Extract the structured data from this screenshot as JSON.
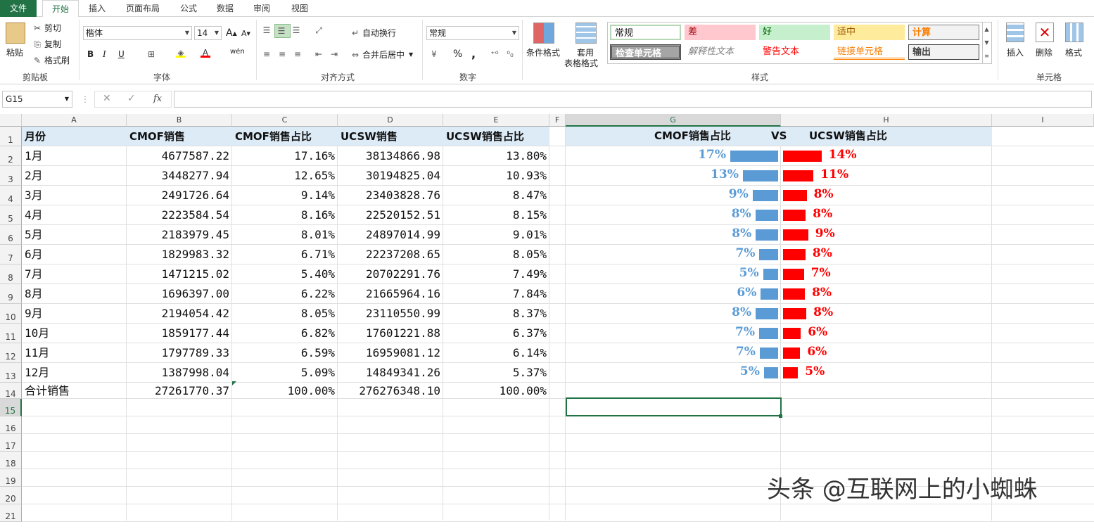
{
  "menu": {
    "file": "文件",
    "tabs": [
      "开始",
      "插入",
      "页面布局",
      "公式",
      "数据",
      "审阅",
      "视图"
    ]
  },
  "ribbon": {
    "clipboard": {
      "label": "剪贴板",
      "paste": "粘贴",
      "cut": "剪切",
      "copy": "复制",
      "format_painter": "格式刷"
    },
    "font": {
      "label": "字体",
      "font_name": "楷体",
      "font_size": "14",
      "bold": "B",
      "italic": "I",
      "underline": "U",
      "grow": "A",
      "shrink": "A",
      "phonetic": "wén"
    },
    "alignment": {
      "label": "对齐方式",
      "wrap": "自动换行",
      "merge": "合并后居中"
    },
    "number": {
      "label": "数字",
      "format": "常规",
      "percent": "%",
      "comma": ","
    },
    "styles": {
      "label": "样式",
      "conditional": "条件格式",
      "table_format_1": "套用",
      "table_format_2": "表格格式",
      "cells": [
        "常规",
        "差",
        "好",
        "适中",
        "计算",
        "检查单元格",
        "解释性文本",
        "警告文本",
        "链接单元格",
        "输出"
      ]
    },
    "cells": {
      "label": "单元格",
      "insert": "插入",
      "delete": "删除",
      "format": "格式"
    }
  },
  "formula_bar": {
    "name_box": "G15",
    "fx": "fx",
    "formula": ""
  },
  "columns": [
    "A",
    "B",
    "C",
    "D",
    "E",
    "F",
    "G",
    "H",
    "I"
  ],
  "rows": [
    "1",
    "2",
    "3",
    "4",
    "5",
    "6",
    "7",
    "8",
    "9",
    "10",
    "11",
    "12",
    "13",
    "14",
    "15",
    "16",
    "17",
    "18",
    "19",
    "20",
    "21"
  ],
  "sheet": {
    "headers": [
      "月份",
      "CMOF销售",
      "CMOF销售占比",
      "UCSW销售",
      "UCSW销售占比"
    ],
    "g1_label": "CMOF销售占比",
    "vs": "VS",
    "h1_label": "UCSW销售占比",
    "data": [
      [
        "1月",
        "4677587.22",
        "17.16%",
        "38134866.98",
        "13.80%"
      ],
      [
        "2月",
        "3448277.94",
        "12.65%",
        "30194825.04",
        "10.93%"
      ],
      [
        "3月",
        "2491726.64",
        "9.14%",
        "23403828.76",
        "8.47%"
      ],
      [
        "4月",
        "2223584.54",
        "8.16%",
        "22520152.51",
        "8.15%"
      ],
      [
        "5月",
        "2183979.45",
        "8.01%",
        "24897014.99",
        "9.01%"
      ],
      [
        "6月",
        "1829983.32",
        "6.71%",
        "22237208.65",
        "8.05%"
      ],
      [
        "7月",
        "1471215.02",
        "5.40%",
        "20702291.76",
        "7.49%"
      ],
      [
        "8月",
        "1696397.00",
        "6.22%",
        "21665964.16",
        "7.84%"
      ],
      [
        "9月",
        "2194054.42",
        "8.05%",
        "23110550.99",
        "8.37%"
      ],
      [
        "10月",
        "1859177.44",
        "6.82%",
        "17601221.88",
        "6.37%"
      ],
      [
        "11月",
        "1797789.33",
        "6.59%",
        "16959081.12",
        "6.14%"
      ],
      [
        "12月",
        "1387998.04",
        "5.09%",
        "14849341.26",
        "5.37%"
      ]
    ],
    "total": [
      "合计销售",
      "27261770.37",
      "100.00%",
      "276276348.10",
      "100.00%"
    ]
  },
  "bars": {
    "cmof_color": "#5b9bd5",
    "ucsw_color": "#ff0000",
    "cmof_pct": [
      17.16,
      12.65,
      9.14,
      8.16,
      8.01,
      6.71,
      5.4,
      6.22,
      8.05,
      6.82,
      6.59,
      5.09
    ],
    "ucsw_pct": [
      13.8,
      10.93,
      8.47,
      8.15,
      9.01,
      8.05,
      7.49,
      7.84,
      8.37,
      6.37,
      6.14,
      5.37
    ],
    "cmof_labels": [
      "17%",
      "13%",
      "9%",
      "8%",
      "8%",
      "7%",
      "5%",
      "6%",
      "8%",
      "7%",
      "7%",
      "5%"
    ],
    "ucsw_labels": [
      "14%",
      "11%",
      "8%",
      "8%",
      "9%",
      "8%",
      "7%",
      "8%",
      "8%",
      "6%",
      "6%",
      "5%"
    ]
  },
  "watermark": "头条 @互联网上的小蜘蛛"
}
